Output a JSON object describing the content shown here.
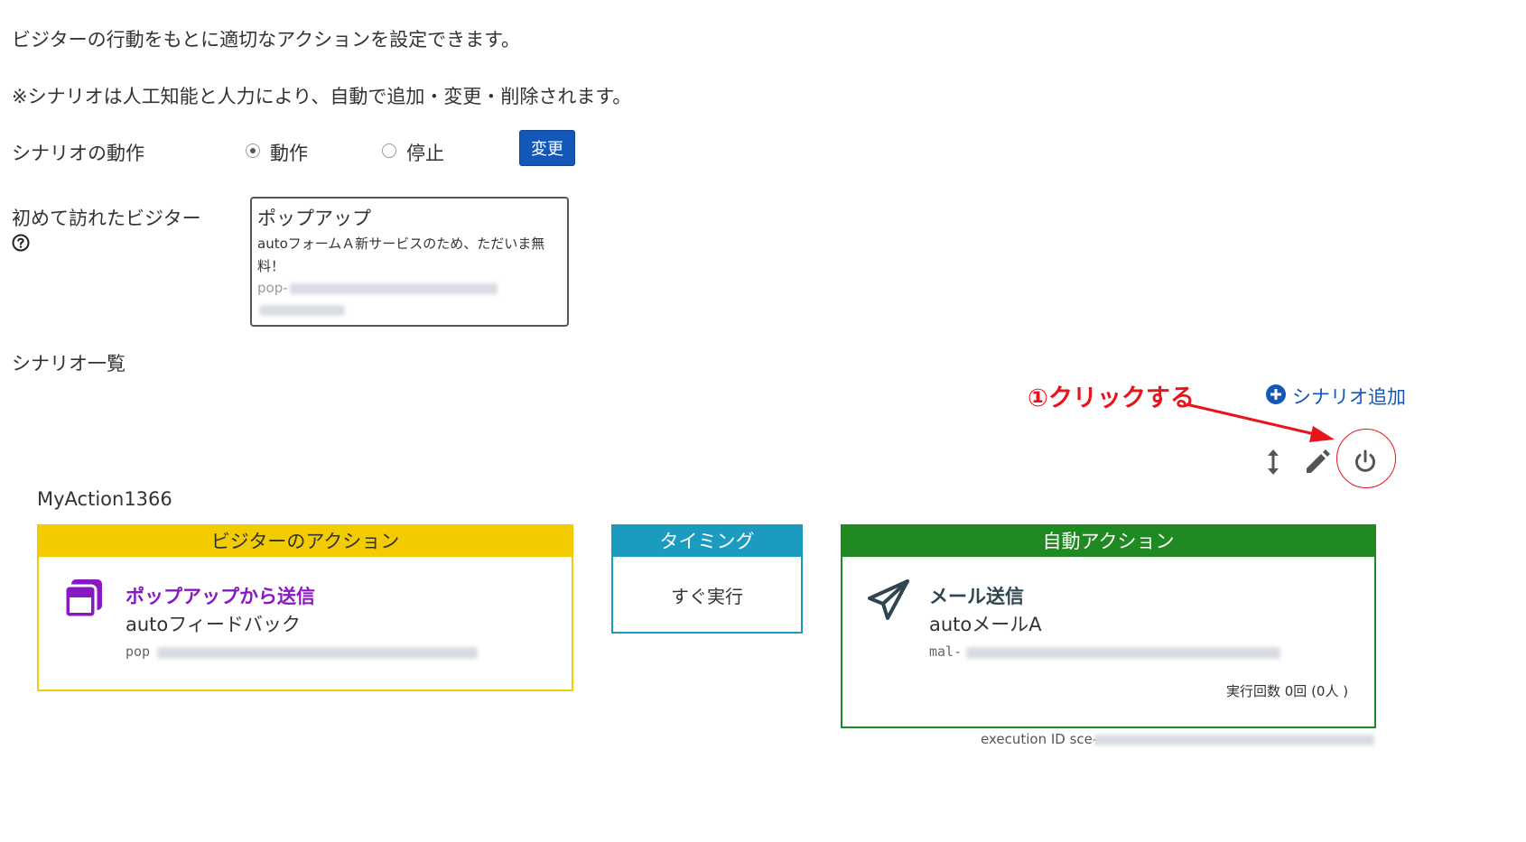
{
  "intro": {
    "line1": "ビジターの行動をもとに適切なアクションを設定できます。",
    "line2": "※シナリオは人工知能と人力により、自動で追加・変更・削除されます。"
  },
  "scenario_mode": {
    "label": "シナリオの動作",
    "option_run": "動作",
    "option_stop": "停止",
    "selected": "動作",
    "change_button": "変更"
  },
  "first_visitor": {
    "label": "初めて訪れたビジター",
    "help_icon": "question-circle-icon",
    "popup": {
      "title": "ポップアップ",
      "description": "autoフォームＡ新サービスのため、ただいま無料！",
      "id_prefix": "pop-"
    }
  },
  "scenario_list": {
    "label": "シナリオ一覧",
    "add_label": "シナリオ追加",
    "annotation": "①クリックする",
    "colors": {
      "annotation": "#e8141b",
      "accent": "#1457b8"
    }
  },
  "toolbar": {
    "icons": [
      "sort-vertical-icon",
      "pencil-icon",
      "power-icon"
    ]
  },
  "scenario": {
    "name": "MyAction1366",
    "visitor_action": {
      "header": "ビジターのアクション",
      "header_color": "#f2cc00",
      "title": "ポップアップから送信",
      "title_color": "#8a17c4",
      "subtitle": "autoフィードバック",
      "id_prefix": "pop"
    },
    "timing": {
      "header": "タイミング",
      "header_color": "#1a9bbf",
      "value": "すぐ実行"
    },
    "auto_action": {
      "header": "自動アクション",
      "header_color": "#1f8a22",
      "title": "メール送信",
      "subtitle": "autoメールA",
      "id_prefix": "mal-",
      "exec_count": "実行回数 0回 (0人 )"
    },
    "execution_id_prefix": "execution ID sce-"
  }
}
